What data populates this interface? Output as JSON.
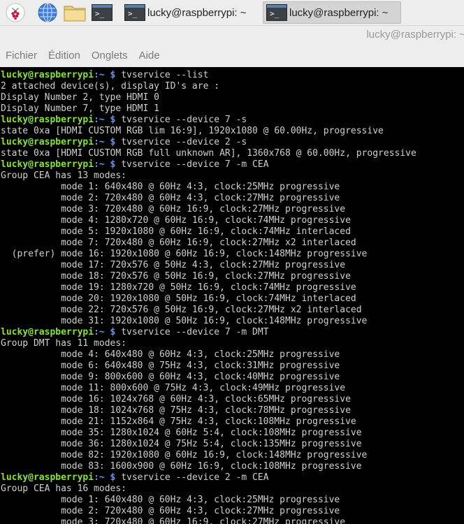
{
  "taskbar": {
    "launchers": [
      "raspberry-pi-menu-icon",
      "globe-icon",
      "folder-icon",
      "terminal-icon"
    ],
    "tasks": [
      {
        "label": "lucky@raspberrypi: ~",
        "active": false
      },
      {
        "label": "lucky@raspberrypi: ~",
        "active": true
      }
    ]
  },
  "window": {
    "title": "lucky@raspberrypi: ~"
  },
  "menu": [
    "Fichier",
    "Édition",
    "Onglets",
    "Aide"
  ],
  "terminal": {
    "prompt_user": "lucky@raspberrypi",
    "prompt_path": ":~",
    "prompt_symbol": " $ ",
    "colors": {
      "background": "#000000",
      "text": "#cfcfcf",
      "user": "#8ae234",
      "path": "#6f8fe6"
    },
    "lines": [
      {
        "type": "prompt",
        "command": "tvservice --list"
      },
      {
        "type": "output",
        "text": "2 attached device(s), display ID's are :"
      },
      {
        "type": "output",
        "text": "Display Number 2, type HDMI 0"
      },
      {
        "type": "output",
        "text": "Display Number 7, type HDMI 1"
      },
      {
        "type": "prompt",
        "command": "tvservice --device 7 -s"
      },
      {
        "type": "output",
        "text": "state 0xa [HDMI CUSTOM RGB lim 16:9], 1920x1080 @ 60.00Hz, progressive"
      },
      {
        "type": "prompt",
        "command": "tvservice --device 2 -s"
      },
      {
        "type": "output",
        "text": "state 0xa [HDMI CUSTOM RGB full unknown AR], 1360x768 @ 60.00Hz, progressive"
      },
      {
        "type": "prompt",
        "command": "tvservice --device 7 -m CEA"
      },
      {
        "type": "output",
        "text": "Group CEA has 13 modes:"
      },
      {
        "type": "output",
        "text": "           mode 1: 640x480 @ 60Hz 4:3, clock:25MHz progressive"
      },
      {
        "type": "output",
        "text": "           mode 2: 720x480 @ 60Hz 4:3, clock:27MHz progressive"
      },
      {
        "type": "output",
        "text": "           mode 3: 720x480 @ 60Hz 16:9, clock:27MHz progressive"
      },
      {
        "type": "output",
        "text": "           mode 4: 1280x720 @ 60Hz 16:9, clock:74MHz progressive"
      },
      {
        "type": "output",
        "text": "           mode 5: 1920x1080 @ 60Hz 16:9, clock:74MHz interlaced"
      },
      {
        "type": "output",
        "text": "           mode 7: 720x480 @ 60Hz 16:9, clock:27MHz x2 interlaced"
      },
      {
        "type": "output",
        "text": "  (prefer) mode 16: 1920x1080 @ 60Hz 16:9, clock:148MHz progressive"
      },
      {
        "type": "output",
        "text": "           mode 17: 720x576 @ 50Hz 4:3, clock:27MHz progressive"
      },
      {
        "type": "output",
        "text": "           mode 18: 720x576 @ 50Hz 16:9, clock:27MHz progressive"
      },
      {
        "type": "output",
        "text": "           mode 19: 1280x720 @ 50Hz 16:9, clock:74MHz progressive"
      },
      {
        "type": "output",
        "text": "           mode 20: 1920x1080 @ 50Hz 16:9, clock:74MHz interlaced"
      },
      {
        "type": "output",
        "text": "           mode 22: 720x576 @ 50Hz 16:9, clock:27MHz x2 interlaced"
      },
      {
        "type": "output",
        "text": "           mode 31: 1920x1080 @ 50Hz 16:9, clock:148MHz progressive"
      },
      {
        "type": "prompt",
        "command": "tvservice --device 7 -m DMT"
      },
      {
        "type": "output",
        "text": "Group DMT has 11 modes:"
      },
      {
        "type": "output",
        "text": "           mode 4: 640x480 @ 60Hz 4:3, clock:25MHz progressive"
      },
      {
        "type": "output",
        "text": "           mode 6: 640x480 @ 75Hz 4:3, clock:31MHz progressive"
      },
      {
        "type": "output",
        "text": "           mode 9: 800x600 @ 60Hz 4:3, clock:40MHz progressive"
      },
      {
        "type": "output",
        "text": "           mode 11: 800x600 @ 75Hz 4:3, clock:49MHz progressive"
      },
      {
        "type": "output",
        "text": "           mode 16: 1024x768 @ 60Hz 4:3, clock:65MHz progressive"
      },
      {
        "type": "output",
        "text": "           mode 18: 1024x768 @ 75Hz 4:3, clock:78MHz progressive"
      },
      {
        "type": "output",
        "text": "           mode 21: 1152x864 @ 75Hz 4:3, clock:108MHz progressive"
      },
      {
        "type": "output",
        "text": "           mode 35: 1280x1024 @ 60Hz 5:4, clock:108MHz progressive"
      },
      {
        "type": "output",
        "text": "           mode 36: 1280x1024 @ 75Hz 5:4, clock:135MHz progressive"
      },
      {
        "type": "output",
        "text": "           mode 82: 1920x1080 @ 60Hz 16:9, clock:148MHz progressive"
      },
      {
        "type": "output",
        "text": "           mode 83: 1600x900 @ 60Hz 16:9, clock:108MHz progressive"
      },
      {
        "type": "prompt",
        "command": "tvservice --device 2 -m CEA"
      },
      {
        "type": "output",
        "text": "Group CEA has 16 modes:"
      },
      {
        "type": "output",
        "text": "           mode 1: 640x480 @ 60Hz 4:3, clock:25MHz progressive"
      },
      {
        "type": "output",
        "text": "           mode 2: 720x480 @ 60Hz 4:3, clock:27MHz progressive"
      },
      {
        "type": "output",
        "text": "           mode 3: 720x480 @ 60Hz 16:9, clock:27MHz progressive"
      }
    ]
  }
}
